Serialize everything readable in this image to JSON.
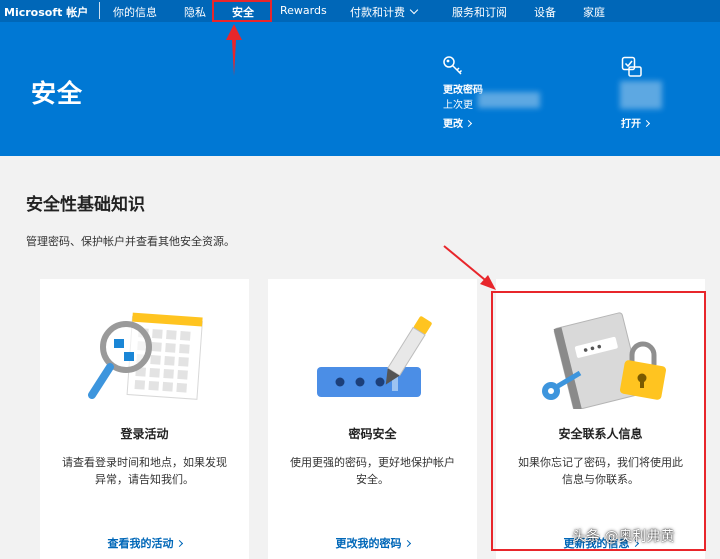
{
  "nav": {
    "brand": "Microsoft 帐户",
    "items": [
      {
        "label": "你的信息"
      },
      {
        "label": "隐私"
      },
      {
        "label": "安全"
      },
      {
        "label": "Rewards"
      },
      {
        "label": "付款和计费"
      },
      {
        "label": "服务和订阅"
      },
      {
        "label": "设备"
      },
      {
        "label": "家庭"
      }
    ]
  },
  "hero": {
    "title": "安全",
    "password": {
      "label": "更改密码",
      "sub": "上次更",
      "link": "更改"
    },
    "two_step": {
      "link": "打开"
    }
  },
  "section": {
    "title": "安全性基础知识",
    "desc": "管理密码、保护帐户并查看其他安全资源。"
  },
  "cards": [
    {
      "title": "登录活动",
      "desc": "请查看登录时间和地点，如果发现异常，请告知我们。",
      "link": "查看我的活动"
    },
    {
      "title": "密码安全",
      "desc": "使用更强的密码，更好地保护帐户安全。",
      "link": "更改我的密码"
    },
    {
      "title": "安全联系人信息",
      "desc": "如果你忘记了密码，我们将使用此信息与你联系。",
      "link": "更新我的信息"
    }
  ],
  "watermark": "头条 @奥利弗黄",
  "colors": {
    "nav": "#0067b8",
    "hero": "#0078d4",
    "link": "#0067b8",
    "annotation": "#e8262b"
  }
}
